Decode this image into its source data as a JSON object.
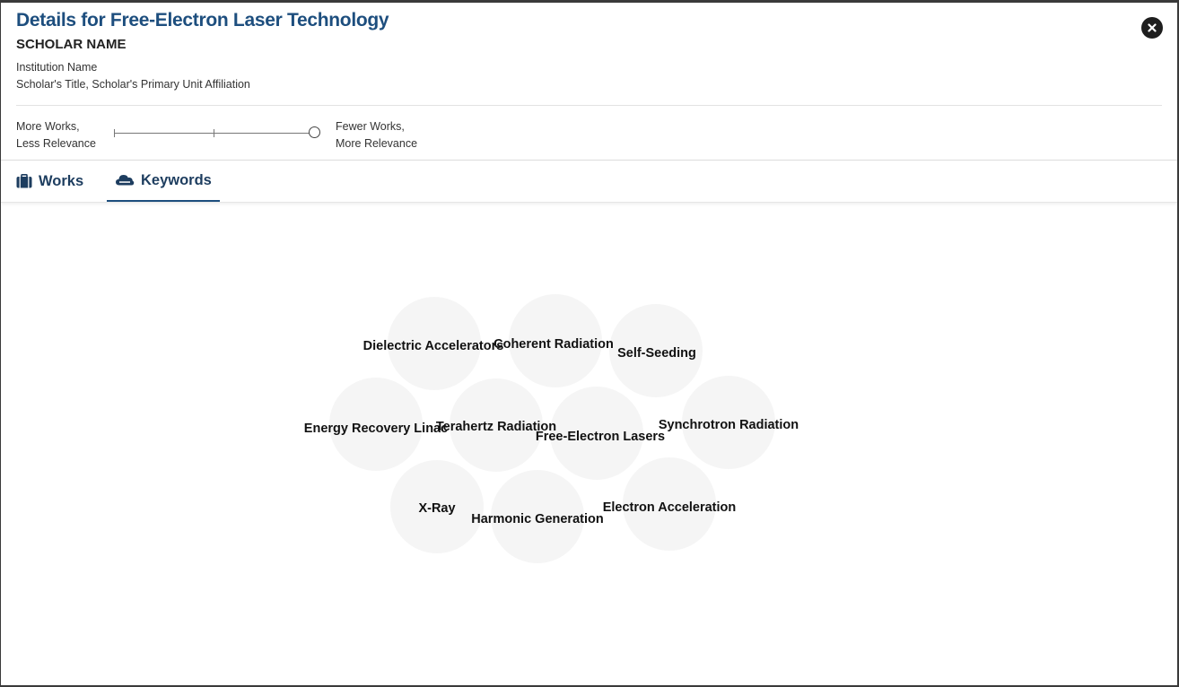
{
  "header": {
    "title": "Details for Free-Electron Laser Technology",
    "scholar_name": "SCHOLAR NAME",
    "institution": "Institution Name",
    "affiliation": "Scholar's Title, Scholar's Primary Unit Affiliation"
  },
  "slider": {
    "left_line1": "More Works,",
    "left_line2": "Less Relevance",
    "right_line1": "Fewer Works,",
    "right_line2": "More Relevance",
    "stops": 3,
    "selected_stop": 3
  },
  "tabs": [
    {
      "label": "Works",
      "icon": "briefcase-icon",
      "active": false
    },
    {
      "label": "Keywords",
      "icon": "cloud-icon",
      "active": true
    }
  ],
  "keywords": [
    "Dielectric Accelerators",
    "Coherent Radiation",
    "Self-Seeding",
    "Energy Recovery Linac",
    "Terahertz Radiation",
    "Free-Electron Lasers",
    "Synchrotron Radiation",
    "X-Ray",
    "Harmonic Generation",
    "Electron Acceleration"
  ],
  "colors": {
    "title": "#1d4e7e",
    "tab_text": "#1d3d5f",
    "bubble_fill": "#f5f5f5"
  }
}
